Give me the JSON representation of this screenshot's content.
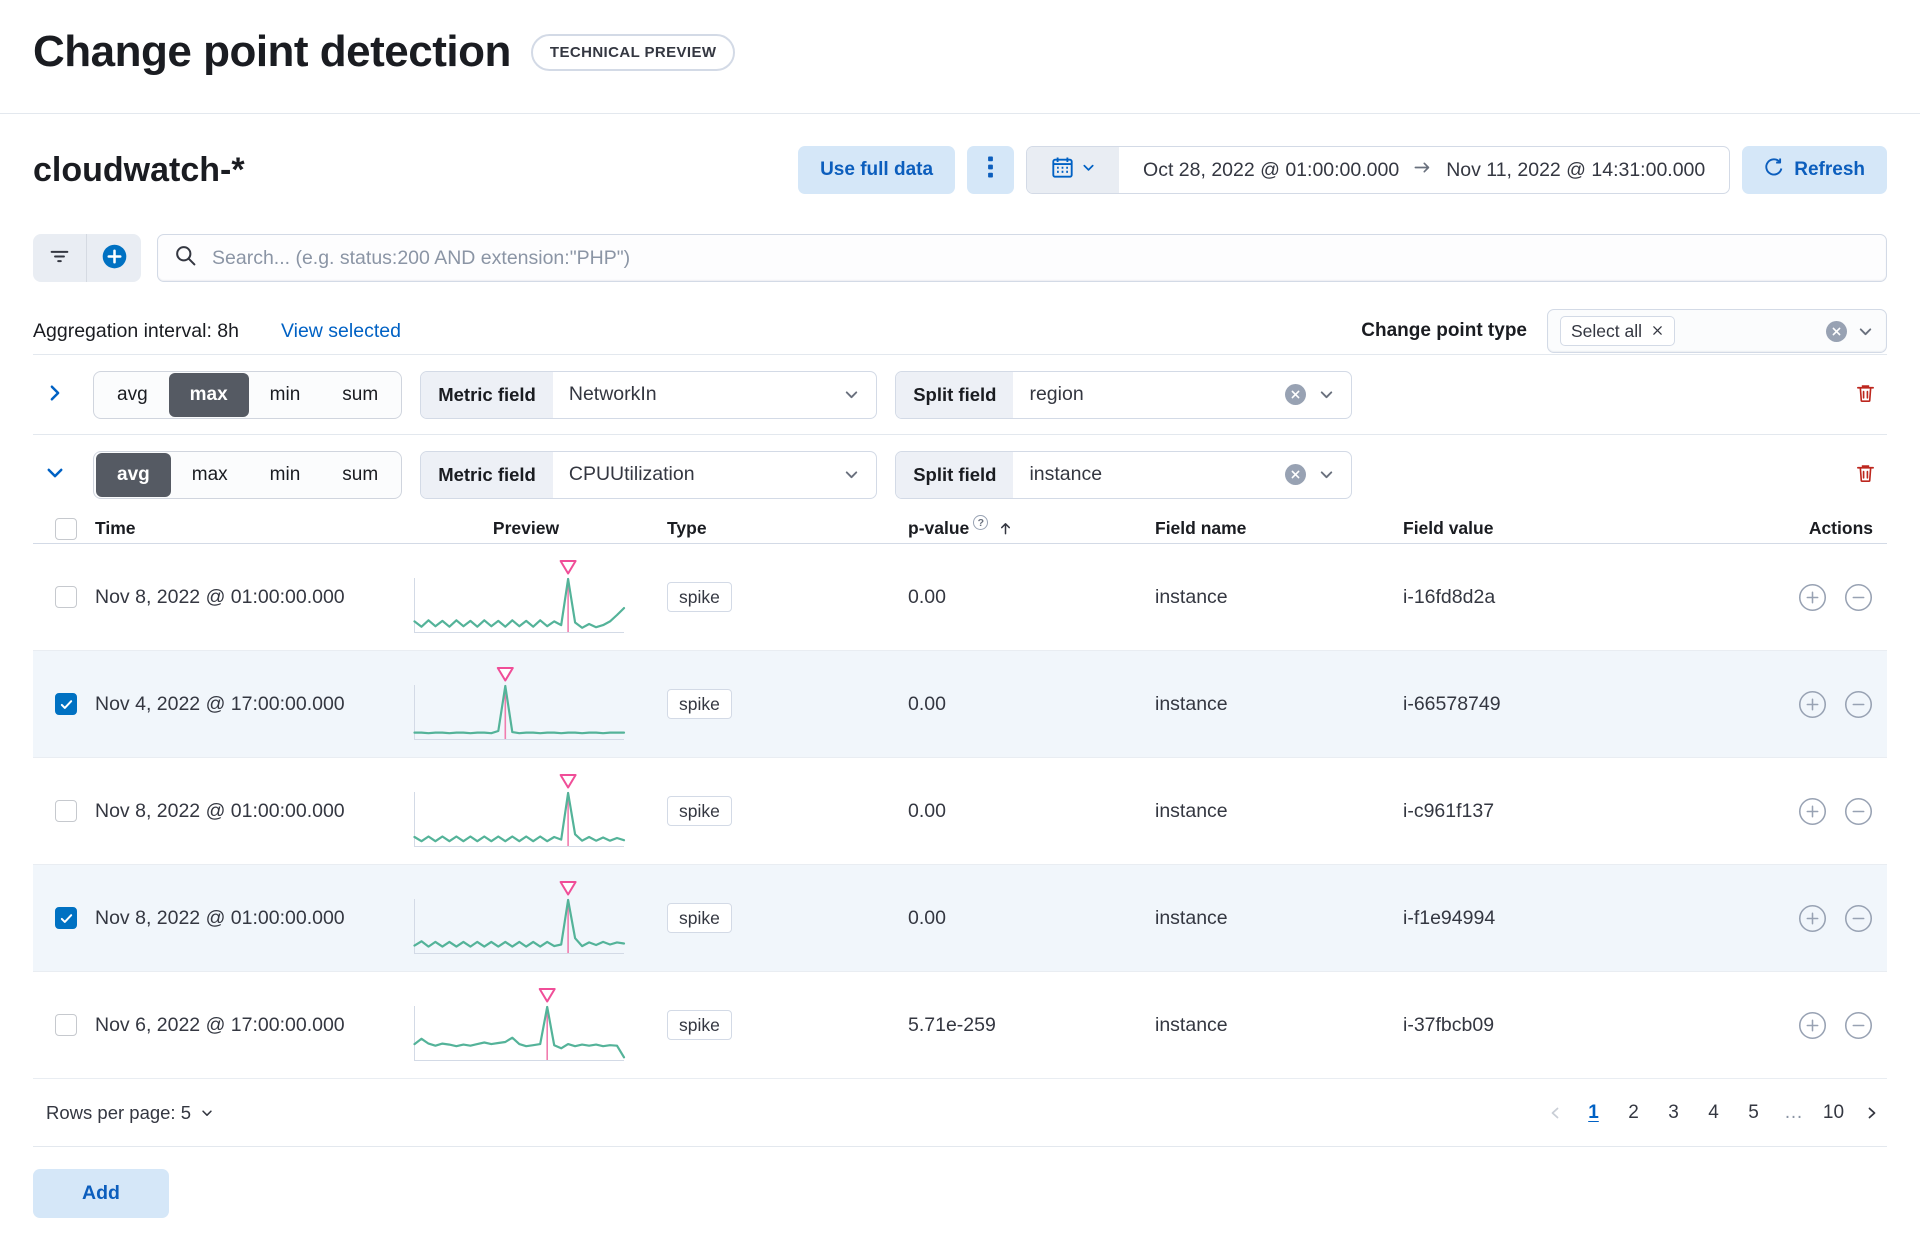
{
  "page": {
    "title": "Change point detection",
    "badge": "TECHNICAL PREVIEW"
  },
  "header": {
    "index_pattern": "cloudwatch-*",
    "use_full_data_label": "Use full data",
    "date_range": {
      "start": "Oct 28, 2022 @ 01:00:00.000",
      "end": "Nov 11, 2022 @ 14:31:00.000"
    },
    "refresh_label": "Refresh"
  },
  "search": {
    "placeholder": "Search... (e.g. status:200 AND extension:\"PHP\")"
  },
  "meta": {
    "aggregation_interval": "Aggregation interval: 8h",
    "view_selected": "View selected",
    "change_point_type_label": "Change point type",
    "change_point_type_value": "Select all"
  },
  "function_options": [
    "avg",
    "max",
    "min",
    "sum"
  ],
  "configs": [
    {
      "expanded": false,
      "selected_function": "max",
      "metric_field_label": "Metric field",
      "metric_field": "NetworkIn",
      "split_field_label": "Split field",
      "split_field": "region"
    },
    {
      "expanded": true,
      "selected_function": "avg",
      "metric_field_label": "Metric field",
      "metric_field": "CPUUtilization",
      "split_field_label": "Split field",
      "split_field": "instance"
    }
  ],
  "table": {
    "columns": [
      "Time",
      "Preview",
      "Type",
      "p-value",
      "Field name",
      "Field value",
      "Actions"
    ],
    "rows": [
      {
        "checked": false,
        "time": "Nov 8, 2022 @ 01:00:00.000",
        "type": "spike",
        "p_value": "0.00",
        "field_name": "instance",
        "field_value": "i-16fd8d2a"
      },
      {
        "checked": true,
        "time": "Nov 4, 2022 @ 17:00:00.000",
        "type": "spike",
        "p_value": "0.00",
        "field_name": "instance",
        "field_value": "i-66578749"
      },
      {
        "checked": false,
        "time": "Nov 8, 2022 @ 01:00:00.000",
        "type": "spike",
        "p_value": "0.00",
        "field_name": "instance",
        "field_value": "i-c961f137"
      },
      {
        "checked": true,
        "time": "Nov 8, 2022 @ 01:00:00.000",
        "type": "spike",
        "p_value": "0.00",
        "field_name": "instance",
        "field_value": "i-f1e94994"
      },
      {
        "checked": false,
        "time": "Nov 6, 2022 @ 17:00:00.000",
        "type": "spike",
        "p_value": "5.71e-259",
        "field_name": "instance",
        "field_value": "i-37fbcb09"
      }
    ]
  },
  "chart_data": [
    {
      "type": "line",
      "name": "preview-i-16fd8d2a",
      "spike_index": 22,
      "values": [
        0.2,
        0.1,
        0.22,
        0.11,
        0.21,
        0.1,
        0.22,
        0.11,
        0.21,
        0.1,
        0.22,
        0.11,
        0.21,
        0.1,
        0.22,
        0.11,
        0.21,
        0.1,
        0.22,
        0.11,
        0.2,
        0.13,
        1.0,
        0.18,
        0.08,
        0.15,
        0.09,
        0.13,
        0.2,
        0.32,
        0.45
      ]
    },
    {
      "type": "line",
      "name": "preview-i-66578749",
      "spike_index": 13,
      "values": [
        0.12,
        0.12,
        0.11,
        0.12,
        0.12,
        0.11,
        0.12,
        0.12,
        0.11,
        0.12,
        0.12,
        0.11,
        0.15,
        1.0,
        0.13,
        0.11,
        0.12,
        0.12,
        0.11,
        0.12,
        0.12,
        0.11,
        0.12,
        0.12,
        0.11,
        0.12,
        0.12,
        0.11,
        0.12,
        0.12,
        0.12
      ]
    },
    {
      "type": "line",
      "name": "preview-i-c961f137",
      "spike_index": 22,
      "values": [
        0.17,
        0.09,
        0.18,
        0.09,
        0.18,
        0.09,
        0.18,
        0.09,
        0.18,
        0.09,
        0.18,
        0.09,
        0.18,
        0.09,
        0.18,
        0.09,
        0.18,
        0.09,
        0.18,
        0.09,
        0.17,
        0.12,
        1.0,
        0.22,
        0.1,
        0.17,
        0.1,
        0.16,
        0.1,
        0.15,
        0.11
      ]
    },
    {
      "type": "line",
      "name": "preview-i-f1e94994",
      "spike_index": 22,
      "values": [
        0.14,
        0.22,
        0.12,
        0.21,
        0.12,
        0.21,
        0.12,
        0.21,
        0.12,
        0.21,
        0.12,
        0.21,
        0.12,
        0.21,
        0.12,
        0.21,
        0.12,
        0.21,
        0.12,
        0.21,
        0.13,
        0.16,
        1.0,
        0.28,
        0.13,
        0.2,
        0.15,
        0.21,
        0.16,
        0.2,
        0.18
      ]
    },
    {
      "type": "line",
      "name": "preview-i-37fbcb09",
      "spike_index": 19,
      "values": [
        0.3,
        0.4,
        0.31,
        0.27,
        0.31,
        0.29,
        0.26,
        0.29,
        0.27,
        0.3,
        0.33,
        0.3,
        0.32,
        0.34,
        0.42,
        0.3,
        0.26,
        0.28,
        0.3,
        1.0,
        0.28,
        0.22,
        0.3,
        0.26,
        0.29,
        0.27,
        0.29,
        0.26,
        0.28,
        0.27,
        0.05
      ]
    }
  ],
  "pagination": {
    "rows_per_page": "Rows per page: 5",
    "pages": [
      "1",
      "2",
      "3",
      "4",
      "5",
      "…",
      "10"
    ],
    "current": "1"
  },
  "footer": {
    "add_label": "Add"
  },
  "colors": {
    "primary": "#0061c4",
    "button_text": "#0c5ebd",
    "button_bg": "#d5e7f8",
    "spark_line": "#54b399",
    "spark_marker": "#f04e98",
    "spark_spike_line": "#f17cae",
    "axis": "#d3dae6",
    "selected_row_bg": "#f1f6fb",
    "danger": "#bd271e",
    "checkbox_checked": "#0071c2",
    "selected_segment": "#555a63"
  }
}
